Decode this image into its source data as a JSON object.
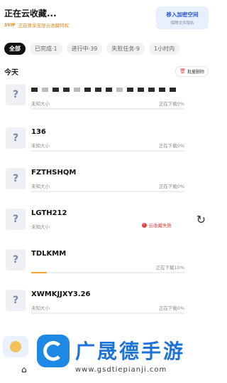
{
  "header": {
    "title": "正在云收藏...",
    "vip_badge": "SVIP",
    "vip_text": "正在尊享无限云收藏特权",
    "move_button": "移入加密空间",
    "move_sub": "保障文件隐私"
  },
  "filters": [
    {
      "label": "全部",
      "active": true
    },
    {
      "label": "已完成·1",
      "active": false
    },
    {
      "label": "进行中·39",
      "active": false
    },
    {
      "label": "失败任务·9",
      "active": false
    },
    {
      "label": "1小时内",
      "active": false
    }
  ],
  "section": {
    "title": "今天",
    "batch_delete": "批量删除"
  },
  "files": [
    {
      "name": "",
      "size": "未知大小",
      "status": "正在下载0%",
      "progress": 0,
      "icon": "question-file-icon",
      "redacted": true
    },
    {
      "name": "136",
      "size": "未知大小",
      "status": "正在下载0%",
      "progress": 0,
      "icon": "question-file-icon"
    },
    {
      "name": "FZTHSHQM",
      "size": "未知大小",
      "status": "正在下载0%",
      "progress": 0,
      "icon": "question-file-icon"
    },
    {
      "name": "LGTH212",
      "size": "未知大小",
      "status": "云收藏失败",
      "failed": true,
      "icon": "question-file-icon",
      "action_icon": "retry-icon"
    },
    {
      "name": "TDLKMM",
      "size": "未知大小",
      "status": "正在下载10%",
      "progress": 0.1,
      "icon": "question-file-icon"
    },
    {
      "name": "XWMKJJXY3.26",
      "size": "未知大小",
      "status": "正在下载0%",
      "progress": 0,
      "icon": "question-file-icon"
    }
  ],
  "watermark": {
    "text": "广晟德手游",
    "url": "www.gsdtiepianji.com"
  },
  "colors": {
    "accent": "#2a58c8",
    "progress": "#f2a33a",
    "fail": "#e04545",
    "watermark": "#1e73d8"
  }
}
